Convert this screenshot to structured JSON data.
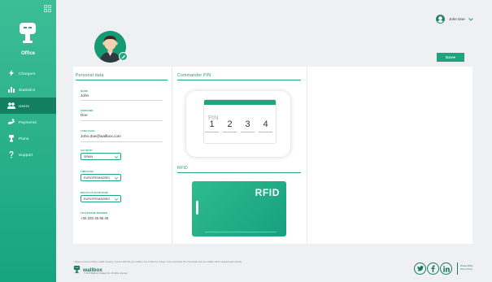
{
  "app": {
    "office_label": "Office"
  },
  "sidebar": {
    "items": [
      {
        "label": "Chargers",
        "icon": "bolt-icon"
      },
      {
        "label": "Statistics",
        "icon": "bar-chart-icon"
      },
      {
        "label": "Users",
        "icon": "users-icon",
        "active": true
      },
      {
        "label": "Payments",
        "icon": "payments-icon"
      },
      {
        "label": "Plans",
        "icon": "plans-icon"
      },
      {
        "label": "Support",
        "icon": "question-icon"
      }
    ]
  },
  "header": {
    "user_name": "John Doe"
  },
  "actions": {
    "save_label": "Save"
  },
  "personal": {
    "title": "Personal data",
    "name_label": "Name",
    "name_value": "John",
    "surname_label": "Surname",
    "surname_value": "Doe",
    "language_label": "Language",
    "language_value": "John.doe@wallbox.com",
    "country_label": "Country",
    "country_value": "SPAIN",
    "timezone_label": "Timezone",
    "timezone_value": "EUROPE/MADRID",
    "defaults_label": "Defaults datezone",
    "defaults_value": "EUROPE/MADRID",
    "phone_label": "Telephone number",
    "phone_value": "+34 333 45 65 45"
  },
  "commander": {
    "title": "Commander PIN",
    "pin_label": "PIN",
    "digits": [
      "1",
      "2",
      "3",
      "4"
    ]
  },
  "rfid": {
    "title": "RFID",
    "card_text": "RFID"
  },
  "footer": {
    "note": "* Please connect a SIM to enable charging. Link the SIM with your wallbox, then restart the charger. Once connected, fill in the details and your wallbox will be updated automatically.",
    "brand": "wallbox",
    "copyright": "© 2019 Wallbox Chargers SL. All rights reserved",
    "links": [
      "Privacy Policy",
      "Terms of Use"
    ],
    "social": [
      "twitter-icon",
      "facebook-icon",
      "linkedin-icon"
    ]
  },
  "colors": {
    "accent": "#1ea47e",
    "sidebar_top": "#3dbd96",
    "sidebar_bottom": "#16a47f",
    "active_nav": "#137f62"
  }
}
